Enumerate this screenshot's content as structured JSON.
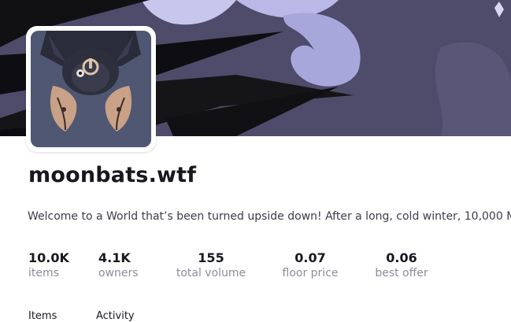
{
  "collection": {
    "name": "moonbats.wtf",
    "description": "Welcome to a World that’s been turned upside down! After a long, cold winter, 10,000 M"
  },
  "stats": [
    {
      "value": "10.0K",
      "label": "items"
    },
    {
      "value": "4.1K",
      "label": "owners"
    },
    {
      "value": "155",
      "label": "total volume"
    },
    {
      "value": "0.07",
      "label": "floor price"
    },
    {
      "value": "0.06",
      "label": "best offer"
    }
  ],
  "tabs": [
    {
      "label": "Items"
    },
    {
      "label": "Activity"
    }
  ],
  "colors": {
    "banner_bg": "#4e4a69",
    "avatar_bg": "#4f5772",
    "label_gray": "#8b8d98"
  }
}
